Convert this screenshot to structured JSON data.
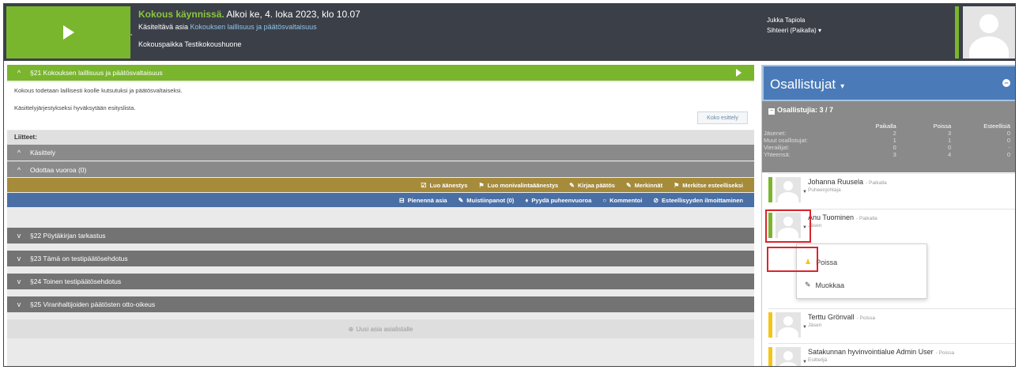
{
  "header": {
    "status_accent": "Kokous käynnissä.",
    "status_rest": " Alkoi ke, 4. loka 2023, klo 10.07",
    "item_prefix": "Käsiteltävä asia ",
    "item_link": "Kokouksen laillisuus ja päätösvaltaisuus",
    "location": "Kokouspaikka Testikokoushuone",
    "user_name": "Jukka Tapiola",
    "user_role": "Sihteeri (Paikalla)",
    "user_caret": "▾"
  },
  "agenda": {
    "active": {
      "label": "§21 Kokouksen laillisuus ja päätösvaltaisuus"
    },
    "content": [
      "Kokous todetaan laillisesti koolle kutsutuksi ja päätösvaltaiseksi.",
      "Käsittelyjärjestykseksi hyväksytään esityslista."
    ],
    "koko_button": "Koko esittely",
    "liitteet": "Liitteet:",
    "kasittely": "Käsittely",
    "odottaa": "Odottaa vuoroa (0)",
    "toolbar1": [
      {
        "icon": "☑",
        "label": "Luo äänestys"
      },
      {
        "icon": "⚑",
        "label": "Luo monivalintaäänestys"
      },
      {
        "icon": "✎",
        "label": "Kirjaa päätös"
      },
      {
        "icon": "✎",
        "label": "Merkinnät"
      },
      {
        "icon": "⚑",
        "label": "Merkitse esteelliseksi"
      }
    ],
    "toolbar2": [
      {
        "icon": "⊟",
        "label": "Pienennä asia"
      },
      {
        "icon": "✎",
        "label": "Muistiinpanot  (0)"
      },
      {
        "icon": "♦",
        "label": "Pyydä puheenvuoroa"
      },
      {
        "icon": "○",
        "label": "Kommentoi"
      },
      {
        "icon": "⊘",
        "label": "Esteellisyyden ilmoittaminen"
      }
    ],
    "collapsed": [
      "§22 Pöytäkirjan tarkastus",
      "§23 Tämä on testipäätösehdotus",
      "§24 Toinen testipäätösehdotus",
      "§25 Viranhaltijoiden päätösten otto-oikeus"
    ],
    "new_item": "Uusi asia asialistalle",
    "icons": {
      "up": "^",
      "down": "v",
      "plus": "⊕"
    }
  },
  "participants_panel": {
    "title": "Osallistujat",
    "caret": "▾",
    "minus_icon": "−",
    "count_label": "Osallistujia: 3 / 7",
    "count_box": "−",
    "columns": [
      "Paikalla",
      "Poissa",
      "Esteellisiä"
    ],
    "rows": [
      {
        "label": "Jäsenet:",
        "values": [
          "2",
          "3",
          "0"
        ]
      },
      {
        "label": "Muut osallistujat:",
        "values": [
          "1",
          "1",
          "0"
        ]
      },
      {
        "label": "Vierailijat:",
        "values": [
          "0",
          "0",
          "-"
        ]
      },
      {
        "label": "Yhteensä:",
        "values": [
          "3",
          "4",
          "0"
        ]
      }
    ],
    "people": [
      {
        "name": "Johanna Ruusela",
        "status": "- Paikalla",
        "role": "Puheenjohtaja",
        "color": "#7ab52e"
      },
      {
        "name": "Anu Tuominen",
        "status": "- Paikalla",
        "role": "Jäsen",
        "color": "#7ab52e"
      },
      {
        "name": "Terttu Grönvall",
        "status": "- Poissa",
        "role": "Jäsen",
        "color": "#f5c518"
      },
      {
        "name": "Satakunnan hyvinvointialue Admin User",
        "status": "- Poissa",
        "role": "Esittelijä",
        "color": "#f5c518"
      }
    ],
    "menu": [
      {
        "icon": "♟",
        "label": "Poissa"
      },
      {
        "icon": "✎",
        "label": "Muokkaa"
      }
    ],
    "menu_colors": {
      "poissa_icon": "#f5c518"
    }
  }
}
